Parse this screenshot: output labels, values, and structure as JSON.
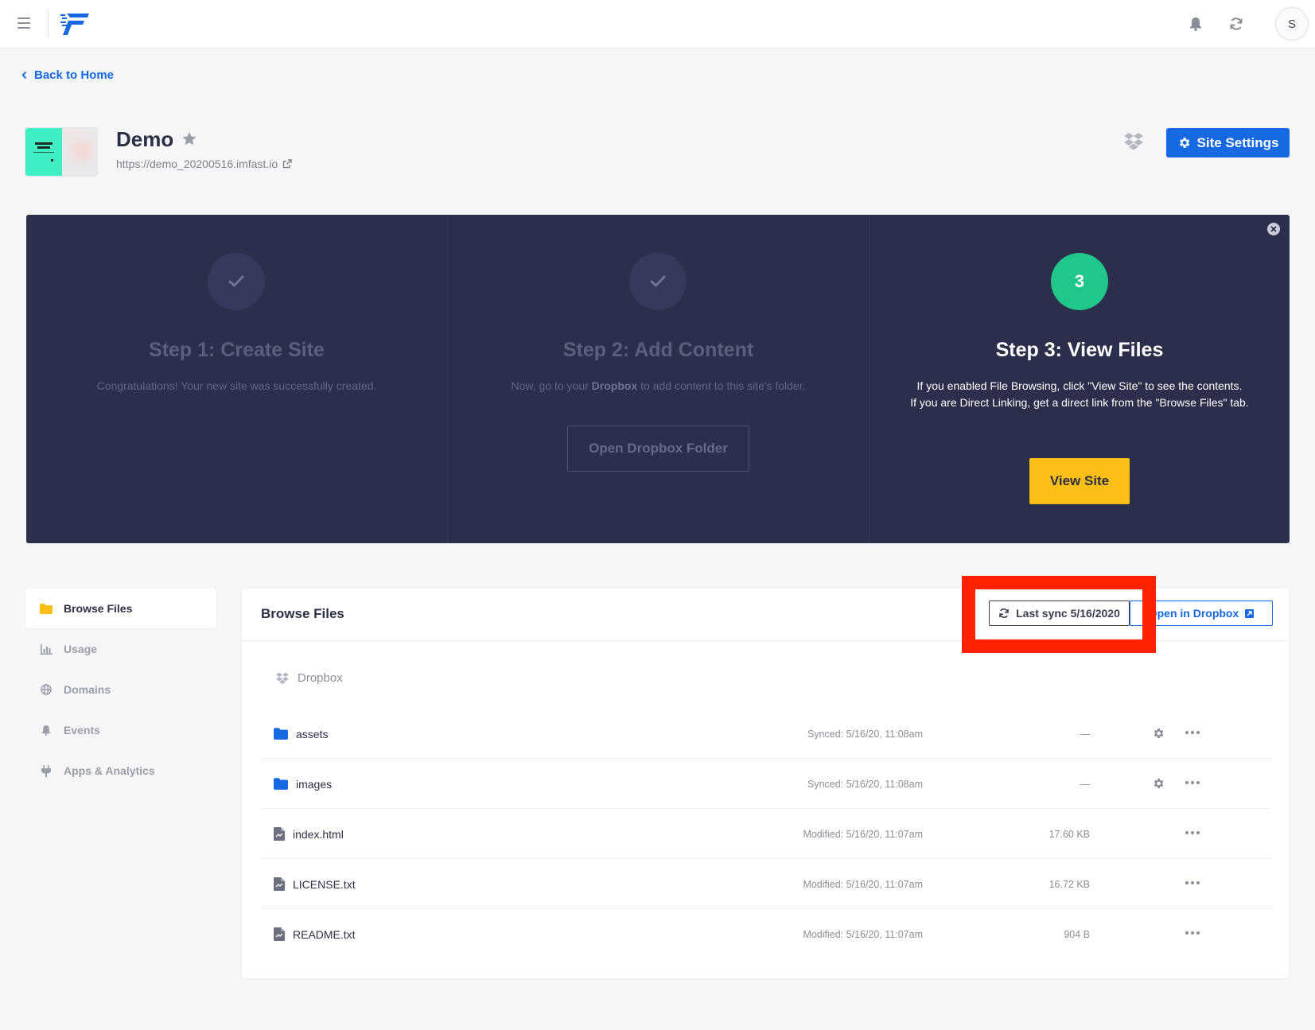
{
  "topbar": {
    "avatar_initial": "S",
    "icons": [
      "menu-icon",
      "bell-icon",
      "refresh-icon"
    ],
    "brand_color": "#1668e3"
  },
  "back_link": "Back to Home",
  "site": {
    "title": "Demo",
    "url": "https://demo_20200516.imfast.io",
    "settings_label": "Site Settings"
  },
  "steps": [
    {
      "title": "Step 1: Create Site",
      "description": "Congratulations! Your new site was successfully created.",
      "state": "done"
    },
    {
      "title": "Step 2: Add Content",
      "description_before": "Now, go to your ",
      "description_bold": "Dropbox",
      "description_after": " to add content to this site's folder.",
      "button": "Open Dropbox Folder",
      "state": "done"
    },
    {
      "number": "3",
      "title": "Step 3: View Files",
      "description_line1": "If you enabled File Browsing, click \"View Site\" to see the contents.",
      "description_line2": "If you are Direct Linking, get a direct link from the \"Browse Files\" tab.",
      "button": "View Site",
      "state": "active"
    }
  ],
  "sidebar": {
    "items": [
      {
        "label": "Browse Files",
        "icon": "folder-icon",
        "active": true
      },
      {
        "label": "Usage",
        "icon": "chart-icon"
      },
      {
        "label": "Domains",
        "icon": "globe-icon"
      },
      {
        "label": "Events",
        "icon": "bell-icon"
      },
      {
        "label": "Apps & Analytics",
        "icon": "plug-icon"
      }
    ]
  },
  "browse": {
    "title": "Browse Files",
    "sync_label": "Last sync 5/16/2020",
    "open_label": "Open in Dropbox",
    "crumb": "Dropbox",
    "files": [
      {
        "name": "assets",
        "type": "folder",
        "status": "Synced: 5/16/20, 11:08am",
        "size": "—"
      },
      {
        "name": "images",
        "type": "folder",
        "status": "Synced: 5/16/20, 11:08am",
        "size": "—"
      },
      {
        "name": "index.html",
        "type": "file",
        "status": "Modified: 5/16/20, 11:07am",
        "size": "17.60 KB"
      },
      {
        "name": "LICENSE.txt",
        "type": "file",
        "status": "Modified: 5/16/20, 11:07am",
        "size": "16.72 KB"
      },
      {
        "name": "README.txt",
        "type": "file",
        "status": "Modified: 5/16/20, 11:07am",
        "size": "904 B"
      }
    ]
  },
  "colors": {
    "accent": "#1668e3",
    "panel": "#2b2f4c",
    "success": "#21c68b",
    "cta": "#fbbf16",
    "highlight": "#ff2200"
  }
}
